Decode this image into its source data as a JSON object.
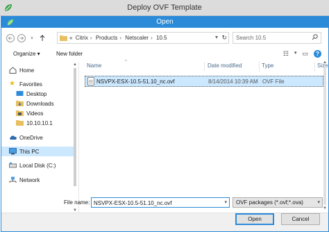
{
  "window": {
    "title": "Deploy OVF Template"
  },
  "dialog": {
    "title": "Open"
  },
  "address": {
    "overflow": "«",
    "crumbs": [
      "Citrix",
      "Products",
      "Netscaler",
      "10.5"
    ]
  },
  "search": {
    "placeholder": "Search 10.5"
  },
  "toolbar": {
    "organize": "Organize ▾",
    "new_folder": "New folder"
  },
  "nav": {
    "home": "Home",
    "favorites": "Favorites",
    "desktop": "Desktop",
    "downloads": "Downloads",
    "videos": "Videos",
    "ip": "10.10.10.1",
    "onedrive": "OneDrive",
    "thispc": "This PC",
    "localdisk": "Local Disk (C:)",
    "network": "Network"
  },
  "columns": {
    "name": "Name",
    "date": "Date modified",
    "type": "Type",
    "size": "Size"
  },
  "files": [
    {
      "name": "NSVPX-ESX-10.5-51.10_nc.ovf",
      "date": "8/14/2014 10:39 AM",
      "type": "OVF File"
    }
  ],
  "footer": {
    "filename_label": "File name:",
    "filename_value": "NSVPX-ESX-10.5-51.10_nc.ovf",
    "filetype": "OVF packages (*.ovf;*.ova)",
    "open": "Open",
    "cancel": "Cancel"
  },
  "colors": {
    "accent": "#2b8bd9",
    "selection": "#cce8ff",
    "folder": "#e8c061",
    "brand": "#3aa14a"
  }
}
